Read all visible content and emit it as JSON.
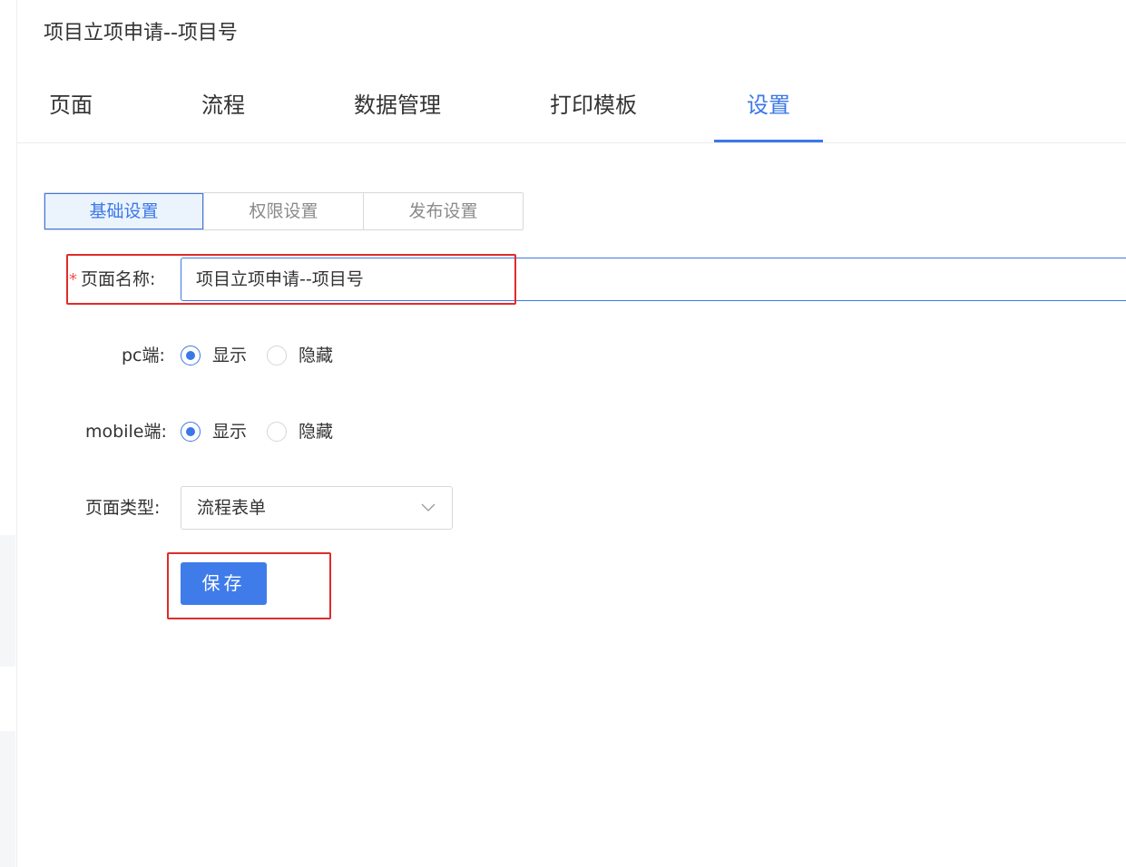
{
  "page": {
    "title": "项目立项申请--项目号"
  },
  "main_tabs": [
    {
      "label": "页面"
    },
    {
      "label": "流程"
    },
    {
      "label": "数据管理"
    },
    {
      "label": "打印模板"
    },
    {
      "label": "设置"
    }
  ],
  "main_tabs_active": "设置",
  "sub_tabs": [
    {
      "label": "基础设置"
    },
    {
      "label": "权限设置"
    },
    {
      "label": "发布设置"
    }
  ],
  "sub_tabs_active": "基础设置",
  "form": {
    "page_name": {
      "required_mark": "*",
      "label": "页面名称:",
      "value": "项目立项申请--项目号"
    },
    "pc": {
      "label": "pc端:",
      "options": [
        "显示",
        "隐藏"
      ],
      "selected": "显示"
    },
    "mobile": {
      "label": "mobile端:",
      "options": [
        "显示",
        "隐藏"
      ],
      "selected": "显示"
    },
    "page_type": {
      "label": "页面类型:",
      "value": "流程表单"
    },
    "save_label": "保存"
  },
  "colors": {
    "accent": "#3b78e7",
    "required": "#f0524f",
    "annotation": "#e02b2b"
  },
  "icons": {
    "select_arrow": "chevron-down-icon"
  }
}
